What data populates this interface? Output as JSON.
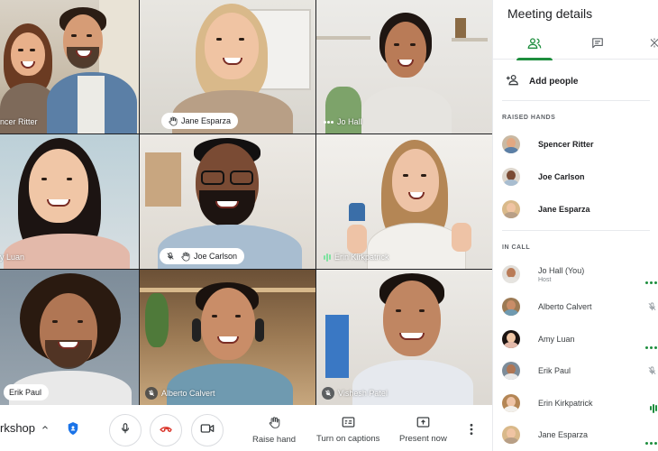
{
  "stage": {
    "tiles": [
      {
        "name": "Spencer Ritter",
        "display_text": "ncer Ritter",
        "chip": false,
        "hand": false,
        "mic_off": false
      },
      {
        "name": "Jane Esparza",
        "display_text": "Jane Esparza",
        "chip": true,
        "hand": true,
        "mic_off": false
      },
      {
        "name": "Jo Hall",
        "display_text": "Jo Hall",
        "chip": false,
        "hand": false,
        "mic_off": false,
        "speaking": true
      },
      {
        "name": "Amy Luan",
        "display_text": "y Luan",
        "chip": false,
        "hand": false,
        "mic_off": false
      },
      {
        "name": "Joe Carlson",
        "display_text": "Joe Carlson",
        "chip": true,
        "hand": true,
        "mic_off": true
      },
      {
        "name": "Erin Kirkpatrick",
        "display_text": "Erin Kirkpatrick",
        "chip": false,
        "hand": false,
        "mic_off": false,
        "speaking": true
      },
      {
        "name": "Erik Paul",
        "display_text": "Erik Paul",
        "chip": true,
        "hand": false,
        "mic_off": false
      },
      {
        "name": "Alberto Calvert",
        "display_text": "Alberto Calvert",
        "chip": false,
        "hand": false,
        "mic_off": true
      },
      {
        "name": "Vishesh Patel",
        "display_text": "Vishesh Patel",
        "chip": false,
        "hand": false,
        "mic_off": true
      }
    ]
  },
  "bottombar": {
    "meeting_name": "rkshop",
    "raise_hand": "Raise hand",
    "captions": "Turn on captions",
    "present": "Present now"
  },
  "panel": {
    "title": "Meeting details",
    "add_people": "Add people",
    "raised_hands_label": "RAISED HANDS",
    "in_call_label": "IN CALL",
    "raised_hands": [
      {
        "name": "Spencer Ritter"
      },
      {
        "name": "Joe Carlson"
      },
      {
        "name": "Jane Esparza"
      }
    ],
    "in_call": [
      {
        "name": "Jo Hall (You)",
        "sub": "Host",
        "status": "speaking-dots"
      },
      {
        "name": "Alberto Calvert",
        "status": "mic-off"
      },
      {
        "name": "Amy Luan",
        "status": "speaking-dots"
      },
      {
        "name": "Erik Paul",
        "status": "mic-off"
      },
      {
        "name": "Erin Kirkpatrick",
        "status": "audio-bars"
      },
      {
        "name": "Jane Esparza",
        "status": "speaking-dots"
      }
    ]
  },
  "colors": {
    "accent_green": "#1e8e3e",
    "hangup_red": "#d93025",
    "shield_blue": "#1a73e8"
  }
}
